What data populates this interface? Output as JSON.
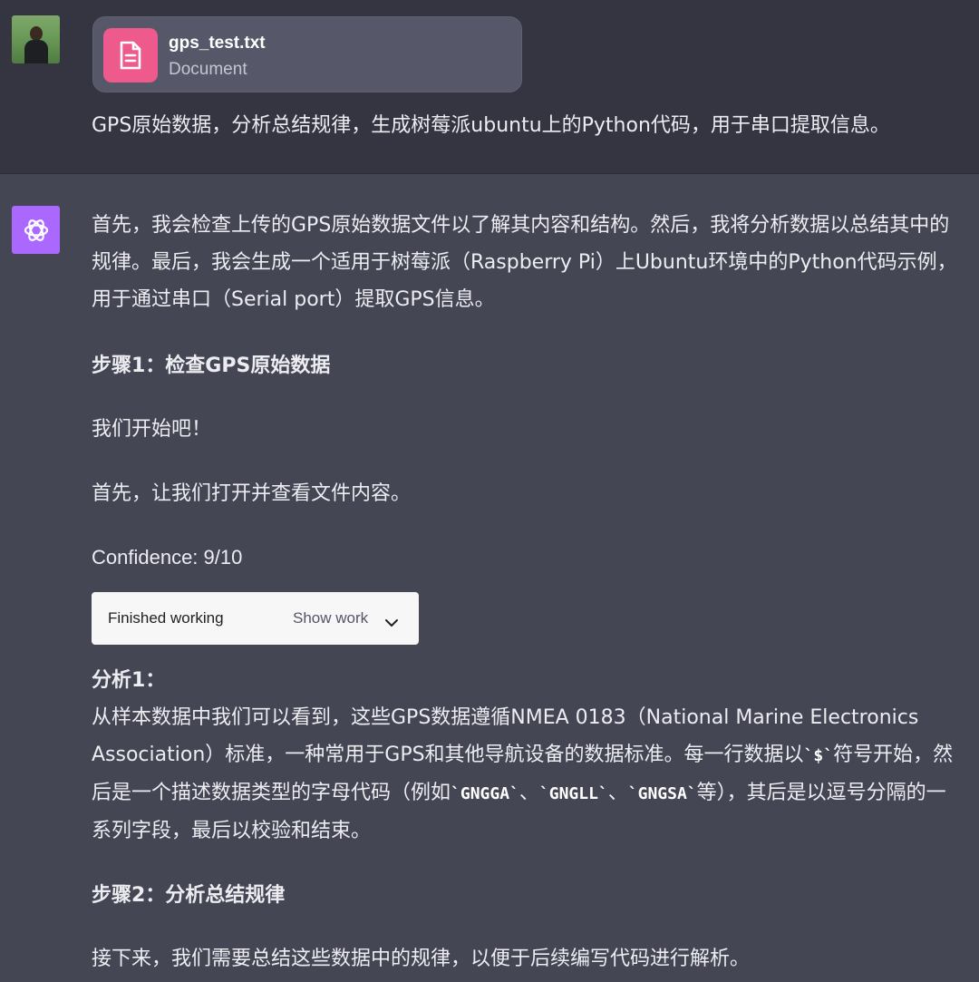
{
  "user": {
    "attachment": {
      "filename": "gps_test.txt",
      "type": "Document",
      "icon": "document-icon"
    },
    "message": "GPS原始数据，分析总结规律，生成树莓派ubuntu上的Python代码，用于串口提取信息。"
  },
  "assistant": {
    "icon": "openai-logo-icon",
    "intro": "首先，我会检查上传的GPS原始数据文件以了解其内容和结构。然后，我将分析数据以总结其中的规律。最后，我会生成一个适用于树莓派（Raspberry Pi）上Ubuntu环境中的Python代码示例，用于通过串口（Serial port）提取GPS信息。",
    "step1_heading": "步骤1：检查GPS原始数据",
    "lets_start": "我们开始吧！",
    "first_open": "首先，让我们打开并查看文件内容。",
    "confidence": "Confidence: 9/10",
    "work": {
      "status": "Finished working",
      "toggle_label": "Show work"
    },
    "analysis_heading": "分析1：",
    "analysis": {
      "part1": "从样本数据中我们可以看到，这些GPS数据遵循NMEA 0183（National Marine Electronics Association）标准，一种常用于GPS和其他导航设备的数据标准。每一行数据以",
      "code1": "`$`",
      "part2": "符号开始，然后是一个描述数据类型的字母代码（例如",
      "code2": "`GNGGA`",
      "sep1": "、",
      "code3": "`GNGLL`",
      "sep2": "、",
      "code4": "`GNGSA`",
      "part3": "等），其后是以逗号分隔的一系列字段，最后以校验和结束。"
    },
    "step2_heading": "步骤2：分析总结规律",
    "next": "接下来，我们需要总结这些数据中的规律，以便于后续编写代码进行解析。"
  },
  "colors": {
    "user_bg": "#343541",
    "assistant_bg": "#444654",
    "file_icon_bg": "#ef5a8c",
    "assistant_avatar_bg": "#ab68ff"
  }
}
